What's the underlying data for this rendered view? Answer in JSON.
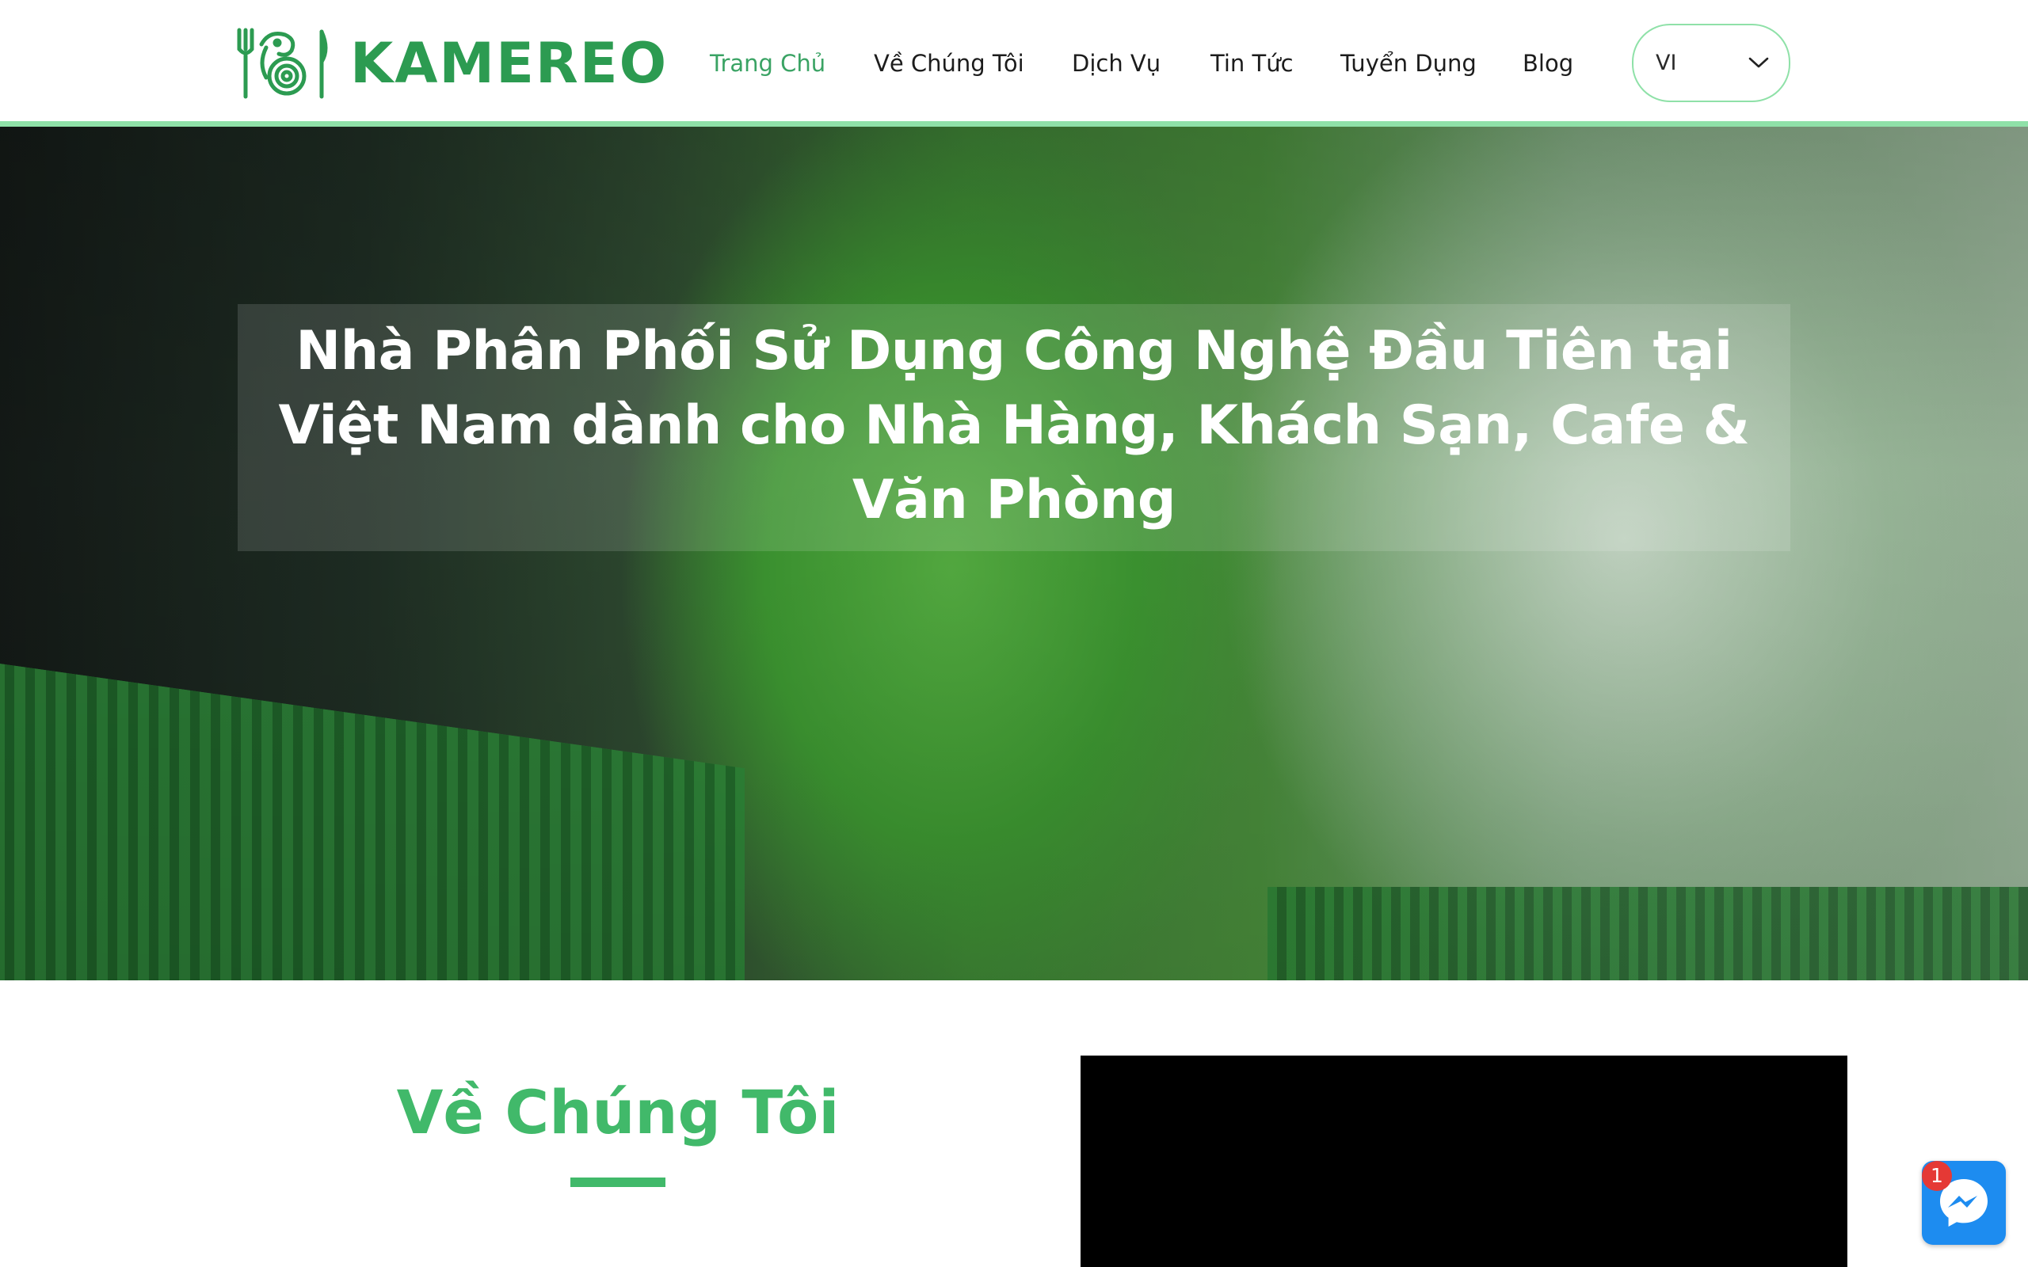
{
  "brand": {
    "name": "KAMEREO",
    "color": "#2c9b51"
  },
  "nav": {
    "items": [
      {
        "label": "Trang Chủ",
        "active": true
      },
      {
        "label": "Về Chúng Tôi",
        "active": false
      },
      {
        "label": "Dịch Vụ",
        "active": false
      },
      {
        "label": "Tin Tức",
        "active": false
      },
      {
        "label": "Tuyển Dụng",
        "active": false
      },
      {
        "label": "Blog",
        "active": false
      }
    ],
    "active_color": "#3aa364"
  },
  "language": {
    "selected": "VI",
    "icon": "chevron-down-icon"
  },
  "hero": {
    "title_lines": [
      "Nhà Phân Phối Sử Dụng Công Nghệ Đầu Tiên tại",
      "Việt Nam dành cho Nhà Hàng, Khách Sạn, Cafe &",
      "Văn Phòng"
    ]
  },
  "about": {
    "title": "Về Chúng Tôi",
    "accent_color": "#41b96a"
  },
  "messenger": {
    "icon": "messenger-icon",
    "badge_count": "1",
    "color": "#1d8cf0"
  }
}
